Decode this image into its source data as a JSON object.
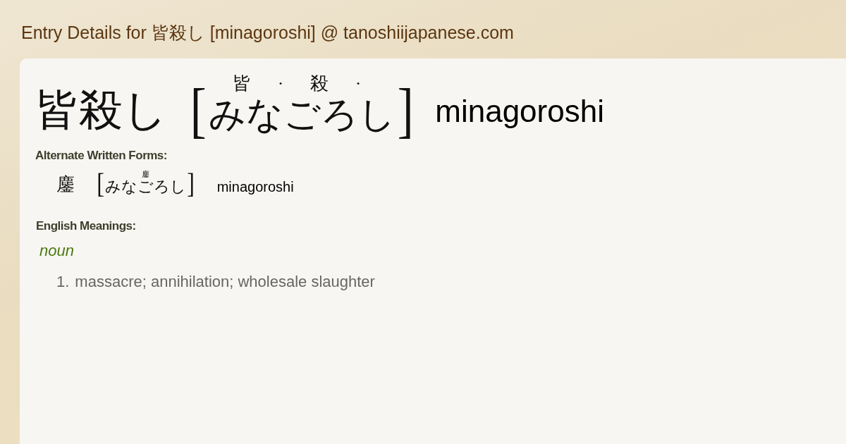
{
  "page_title": "Entry Details for 皆殺し [minagoroshi] @ tanoshiijapanese.com",
  "entry": {
    "written": "皆殺し",
    "open_bracket": "[",
    "furigana": [
      "皆",
      "·",
      "殺",
      "·"
    ],
    "reading": "みなごろし",
    "close_bracket": "]",
    "romaji": "minagoroshi"
  },
  "alternate_forms": {
    "heading": "Alternate Written Forms:",
    "items": [
      {
        "written": "鏖",
        "open_bracket": "[",
        "furigana": "鏖",
        "reading": "みなごろし",
        "close_bracket": "]",
        "romaji": "minagoroshi"
      }
    ]
  },
  "meanings": {
    "heading": "English Meanings:",
    "groups": [
      {
        "part_of_speech": "noun",
        "senses": [
          {
            "number": "1.",
            "text": "massacre; annihilation; wholesale slaughter"
          }
        ]
      }
    ]
  }
}
